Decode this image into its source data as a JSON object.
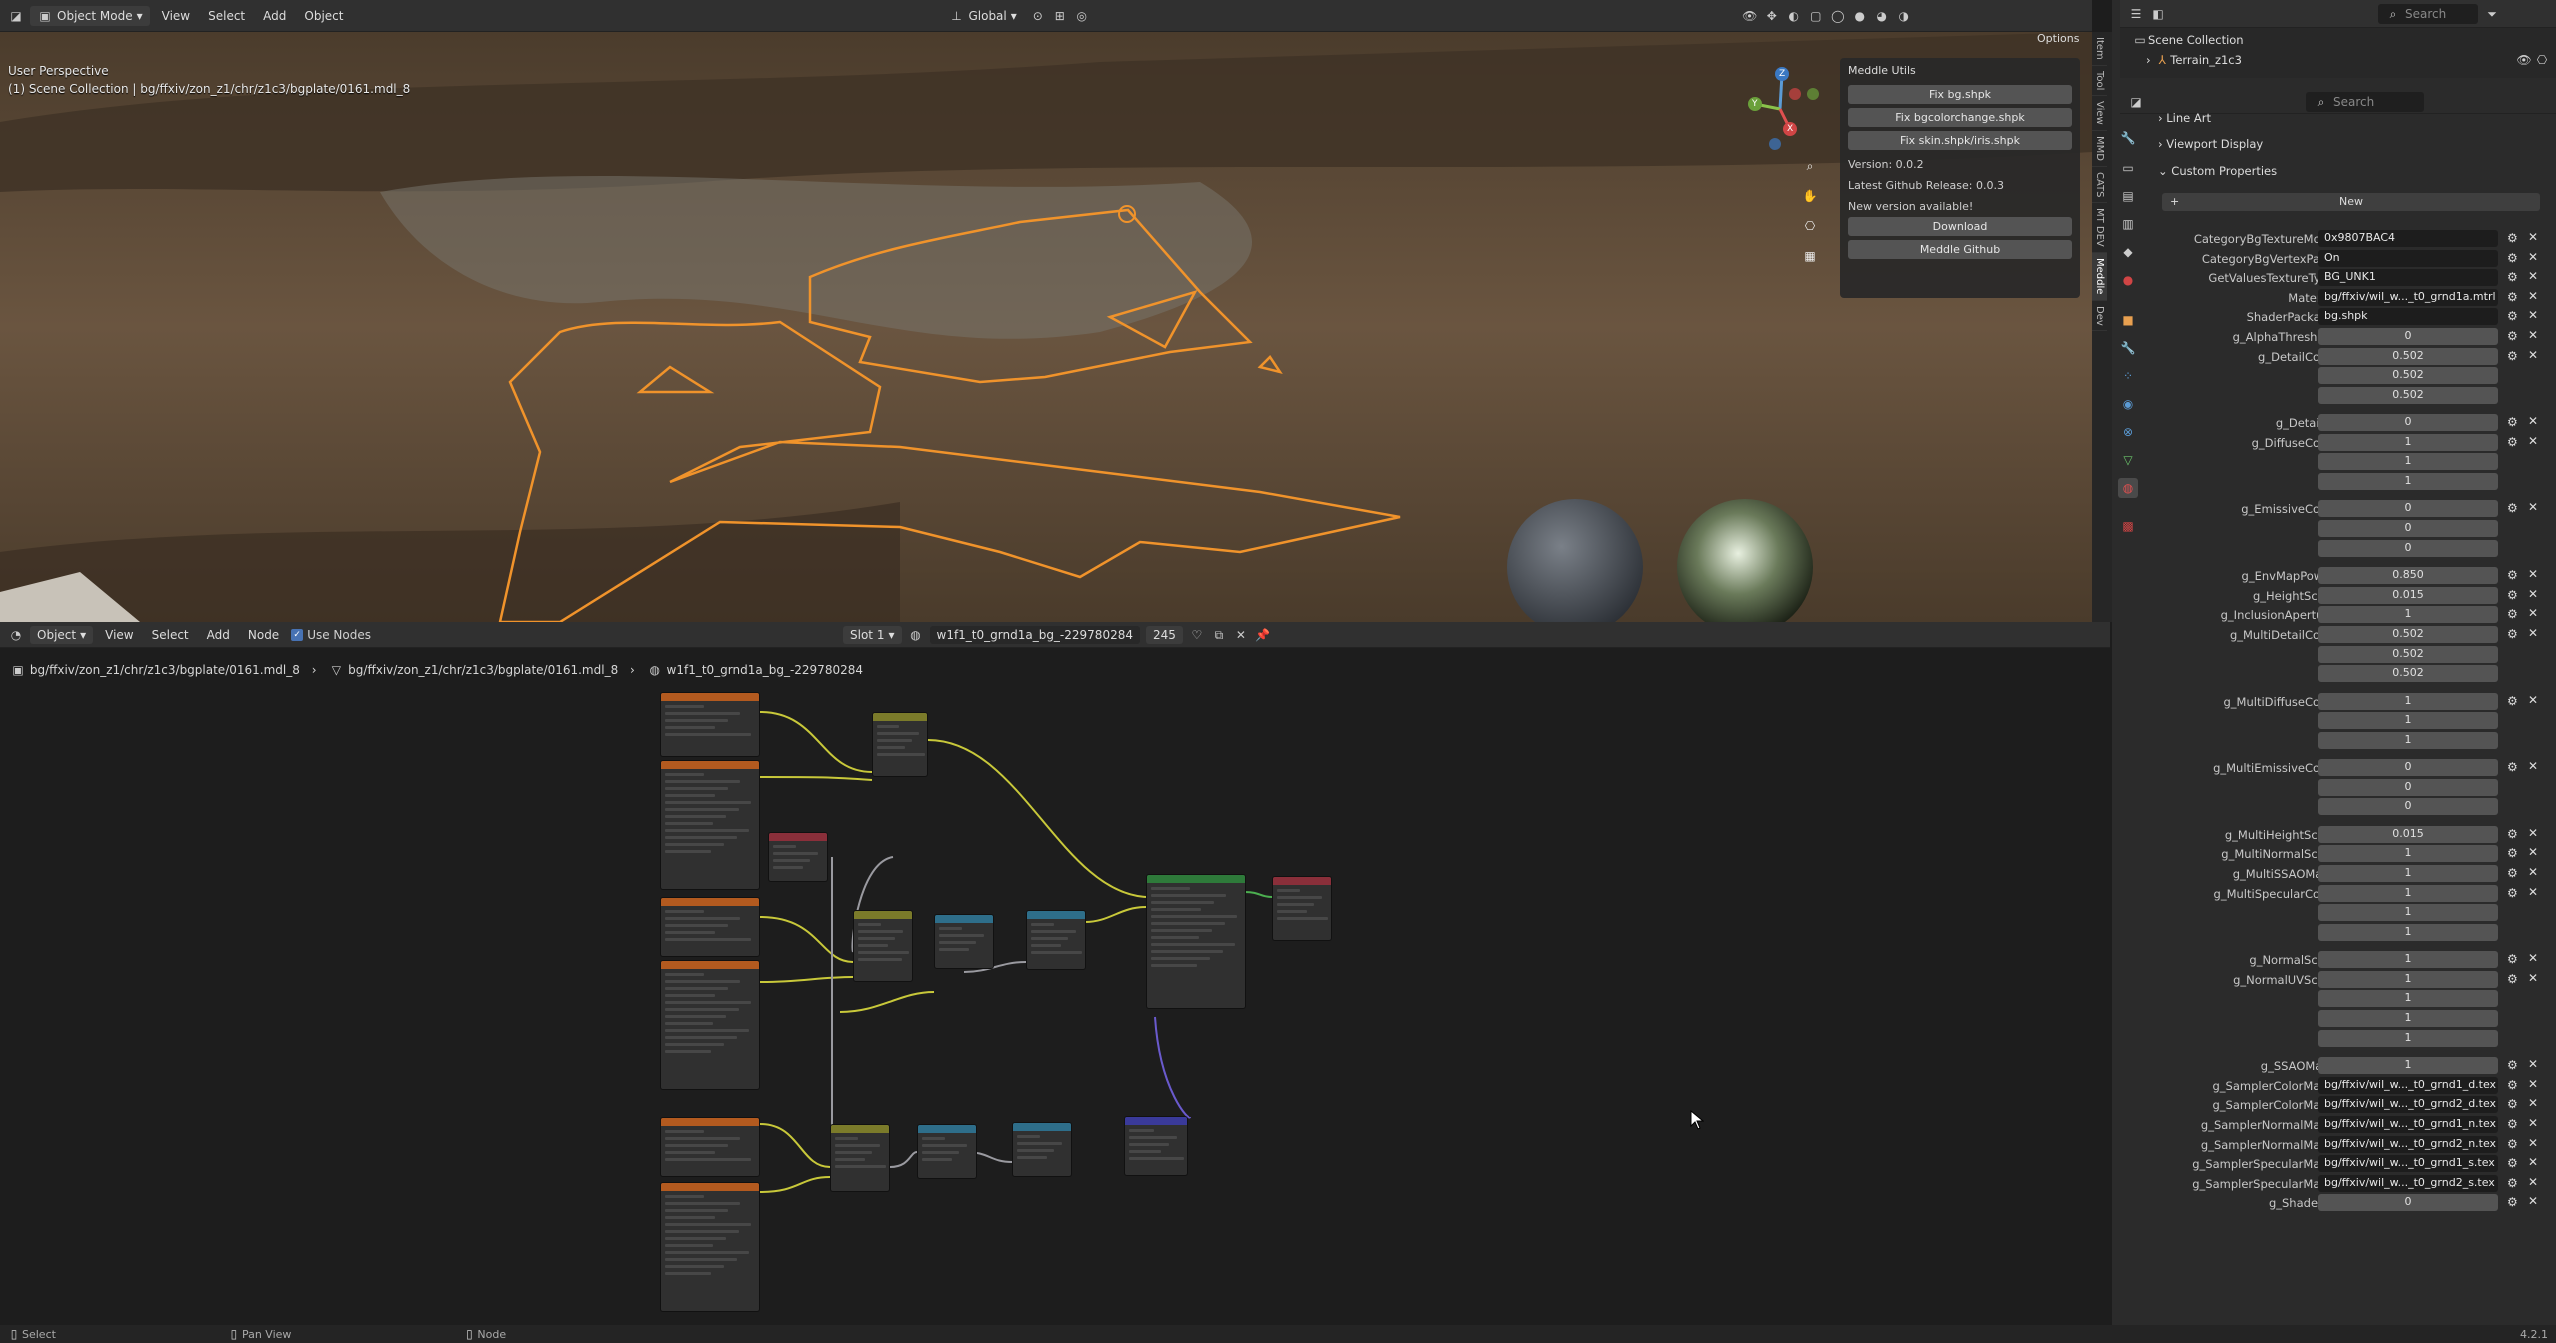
{
  "top_header": {
    "mode": "Object Mode",
    "menus": [
      "View",
      "Select",
      "Add",
      "Object"
    ],
    "transform_orientation": "Global",
    "options": "Options",
    "search_placeholder": "Search"
  },
  "viewport": {
    "perspective": "User Perspective",
    "collection_path": "(1) Scene Collection | bg/ffxiv/zon_z1/chr/z1c3/bgplate/0161.mdl_8",
    "gizmo_axes": [
      "Z",
      "Y",
      "X"
    ]
  },
  "meddle_panel": {
    "title": "Meddle Utils",
    "fix_buttons": [
      "Fix bg.shpk",
      "Fix bgcolorchange.shpk",
      "Fix skin.shpk/iris.shpk"
    ],
    "version": "Version: 0.0.2",
    "latest": "Latest Github Release: 0.0.3",
    "new_version": "New version available!",
    "download": "Download",
    "github": "Meddle Github"
  },
  "side_tabs": [
    "Item",
    "Tool",
    "View",
    "MMD",
    "CATS",
    "MT DEV",
    "Meddle",
    "Dev"
  ],
  "node_header": {
    "editor": "Object",
    "menus": [
      "View",
      "Select",
      "Add",
      "Node"
    ],
    "use_nodes": "Use Nodes",
    "slot": "Slot 1",
    "material": "w1f1_t0_grnd1a_bg_-229780284",
    "users": "245"
  },
  "breadcrumb": [
    "bg/ffxiv/zon_z1/chr/z1c3/bgplate/0161.mdl_8",
    "bg/ffxiv/zon_z1/chr/z1c3/bgplate/0161.mdl_8",
    "w1f1_t0_grnd1a_bg_-229780284"
  ],
  "outliner": {
    "root": "Scene Collection",
    "child": "Terrain_z1c3"
  },
  "properties": {
    "search_placeholder": "Search",
    "sections": [
      "Line Art",
      "Viewport Display",
      "Custom Properties"
    ],
    "new_button": "New",
    "rows": [
      {
        "label": "CategoryBgTextureMode",
        "values": [
          "0x9807BAC4"
        ],
        "kind": "text"
      },
      {
        "label": "CategoryBgVertexPaint",
        "values": [
          "On"
        ],
        "kind": "text"
      },
      {
        "label": "GetValuesTextureType",
        "values": [
          "BG_UNK1"
        ],
        "kind": "text"
      },
      {
        "label": "Material",
        "values": [
          "bg/ffxiv/wil_w..._t0_grnd1a.mtrl"
        ],
        "kind": "text"
      },
      {
        "label": "ShaderPackage",
        "values": [
          "bg.shpk"
        ],
        "kind": "text"
      },
      {
        "label": "g_AlphaThreshold",
        "values": [
          "0"
        ],
        "kind": "num"
      },
      {
        "label": "g_DetailColor",
        "values": [
          "0.502",
          "0.502",
          "0.502"
        ],
        "kind": "num"
      },
      {
        "label": "g_DetailID",
        "values": [
          "0"
        ],
        "kind": "num"
      },
      {
        "label": "g_DiffuseColor",
        "values": [
          "1",
          "1",
          "1"
        ],
        "kind": "num"
      },
      {
        "label": "g_EmissiveColor",
        "values": [
          "0",
          "0",
          "0"
        ],
        "kind": "num"
      },
      {
        "label": "g_EnvMapPower",
        "values": [
          "0.850"
        ],
        "kind": "num"
      },
      {
        "label": "g_HeightScale",
        "values": [
          "0.015"
        ],
        "kind": "num"
      },
      {
        "label": "g_InclusionAperture",
        "values": [
          "1"
        ],
        "kind": "num"
      },
      {
        "label": "g_MultiDetailColor",
        "values": [
          "0.502",
          "0.502",
          "0.502"
        ],
        "kind": "num"
      },
      {
        "label": "g_MultiDiffuseColor",
        "values": [
          "1",
          "1",
          "1"
        ],
        "kind": "num"
      },
      {
        "label": "g_MultiEmissiveColor",
        "values": [
          "0",
          "0",
          "0"
        ],
        "kind": "num"
      },
      {
        "label": "g_MultiHeightScale",
        "values": [
          "0.015"
        ],
        "kind": "num"
      },
      {
        "label": "g_MultiNormalScale",
        "values": [
          "1"
        ],
        "kind": "num"
      },
      {
        "label": "g_MultiSSAOMask",
        "values": [
          "1"
        ],
        "kind": "num"
      },
      {
        "label": "g_MultiSpecularColor",
        "values": [
          "1",
          "1",
          "1"
        ],
        "kind": "num"
      },
      {
        "label": "g_NormalScale",
        "values": [
          "1"
        ],
        "kind": "num"
      },
      {
        "label": "g_NormalUVScale",
        "values": [
          "1",
          "1",
          "1",
          "1"
        ],
        "kind": "num"
      },
      {
        "label": "g_SSAOMask",
        "values": [
          "1"
        ],
        "kind": "num"
      },
      {
        "label": "g_SamplerColorMap0",
        "values": [
          "bg/ffxiv/wil_w..._t0_grnd1_d.tex"
        ],
        "kind": "text"
      },
      {
        "label": "g_SamplerColorMap1",
        "values": [
          "bg/ffxiv/wil_w..._t0_grnd2_d.tex"
        ],
        "kind": "text"
      },
      {
        "label": "g_SamplerNormalMap0",
        "values": [
          "bg/ffxiv/wil_w..._t0_grnd1_n.tex"
        ],
        "kind": "text"
      },
      {
        "label": "g_SamplerNormalMap1",
        "values": [
          "bg/ffxiv/wil_w..._t0_grnd2_n.tex"
        ],
        "kind": "text"
      },
      {
        "label": "g_SamplerSpecularMap0",
        "values": [
          "bg/ffxiv/wil_w..._t0_grnd1_s.tex"
        ],
        "kind": "text"
      },
      {
        "label": "g_SamplerSpecularMap1",
        "values": [
          "bg/ffxiv/wil_w..._t0_grnd2_s.tex"
        ],
        "kind": "text"
      },
      {
        "label": "g_ShaderID",
        "values": [
          "0"
        ],
        "kind": "num"
      }
    ]
  },
  "status_bar": {
    "items": [
      "Select",
      "Pan View",
      "Node"
    ],
    "version": "4.2.1"
  },
  "colors": {
    "selection_outline": "#f0932b",
    "node_header_texture": "#b35a1f",
    "node_header_mix": "#7b7b2a",
    "node_header_vector": "#2e6e8a",
    "node_header_shader": "#2e7a3a",
    "node_header_output": "#8a2f3a",
    "node_header_normal": "#3a3a9a",
    "link_color": "#c8c83a"
  }
}
